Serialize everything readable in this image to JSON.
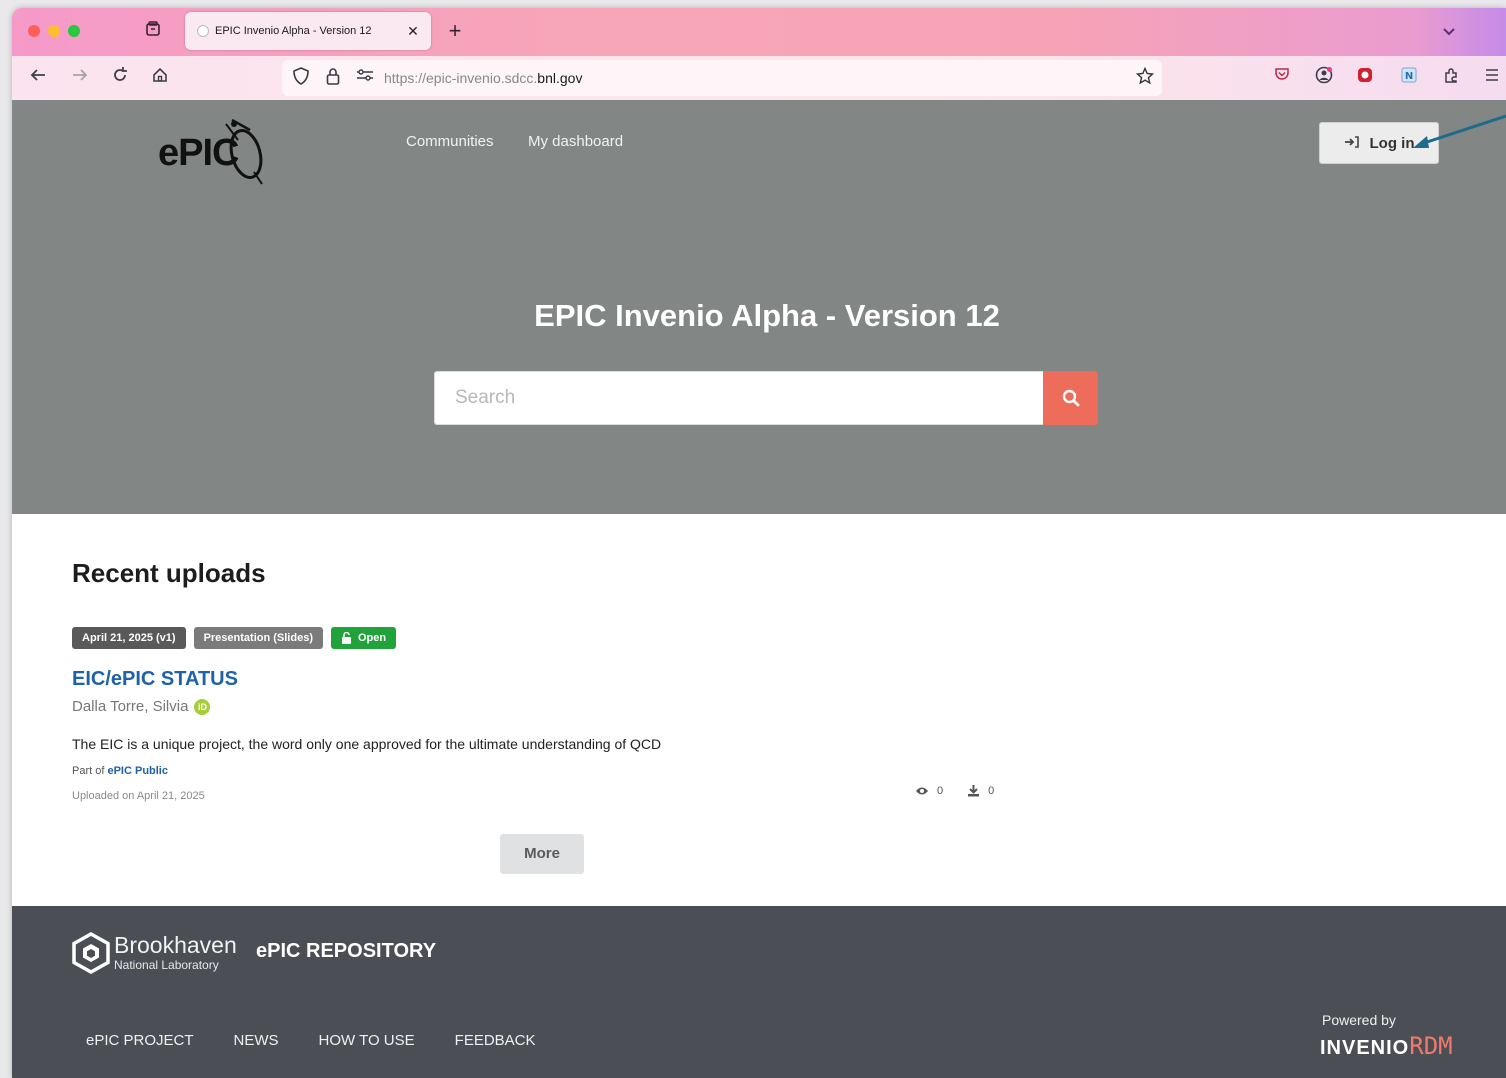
{
  "browser": {
    "tab_title": "EPIC Invenio Alpha - Version 12",
    "tab_close": "✕",
    "new_tab": "+",
    "url_prefix": "https://epic-invenio.sdcc.",
    "url_domain": "bnl.gov"
  },
  "header": {
    "logo_text": "ePIC",
    "nav": [
      "Communities",
      "My dashboard"
    ],
    "login_label": "Log in"
  },
  "hero": {
    "title": "EPIC Invenio Alpha - Version 12",
    "search_placeholder": "Search"
  },
  "recent": {
    "section_title": "Recent uploads",
    "record": {
      "badge_date": "April 21, 2025 (v1)",
      "badge_type": "Presentation (Slides)",
      "badge_access": "Open",
      "title": "EIC/ePIC STATUS",
      "author": "Dalla Torre, Silvia",
      "description": "The EIC is a unique project, the word only one approved for the ultimate understanding of QCD",
      "part_of_prefix": "Part of",
      "part_of_link": "ePIC Public",
      "uploaded": "Uploaded on April 21, 2025",
      "views": "0",
      "downloads": "0"
    },
    "more_label": "More"
  },
  "footer": {
    "org_name": "Brookhaven",
    "org_sub": "National Laboratory",
    "repo_name": "ePIC REPOSITORY",
    "links": [
      "ePIC PROJECT",
      "NEWS",
      "HOW TO USE",
      "FEEDBACK"
    ],
    "powered_by": "Powered by",
    "invenio_main": "INVENIO",
    "invenio_rdm": "RDM"
  },
  "colors": {
    "hero_bg": "#828685",
    "search_button": "#ee6d5a",
    "record_title": "#1f62a8",
    "open_badge": "#21a23a",
    "footer_bg": "#4b4e55"
  }
}
